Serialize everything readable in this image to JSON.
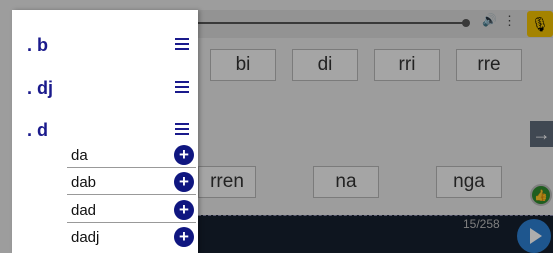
{
  "app": {
    "counter": "15/258",
    "syllables_row1": [
      "bi",
      "di",
      "rri",
      "rre"
    ],
    "syllables_row2": [
      "rren",
      "na",
      "nga"
    ]
  },
  "drawer": {
    "categories": [
      ". b",
      ". dj",
      ". d"
    ],
    "words": [
      "da",
      "dab",
      "dad",
      "dadj"
    ],
    "add_symbol": "+"
  },
  "icons": {
    "volume": "volume-icon",
    "more": "more-vert-icon",
    "mic": "microphone-icon",
    "next": "arrow-right-icon",
    "thumbs_up": "thumbs-up-icon",
    "play": "play-icon",
    "menu": "hamburger-menu-icon"
  },
  "colors": {
    "accent": "#1a1a8c",
    "add_button": "#0f1680",
    "mic_button": "#f2c200",
    "play_button": "#2d7fd1"
  }
}
